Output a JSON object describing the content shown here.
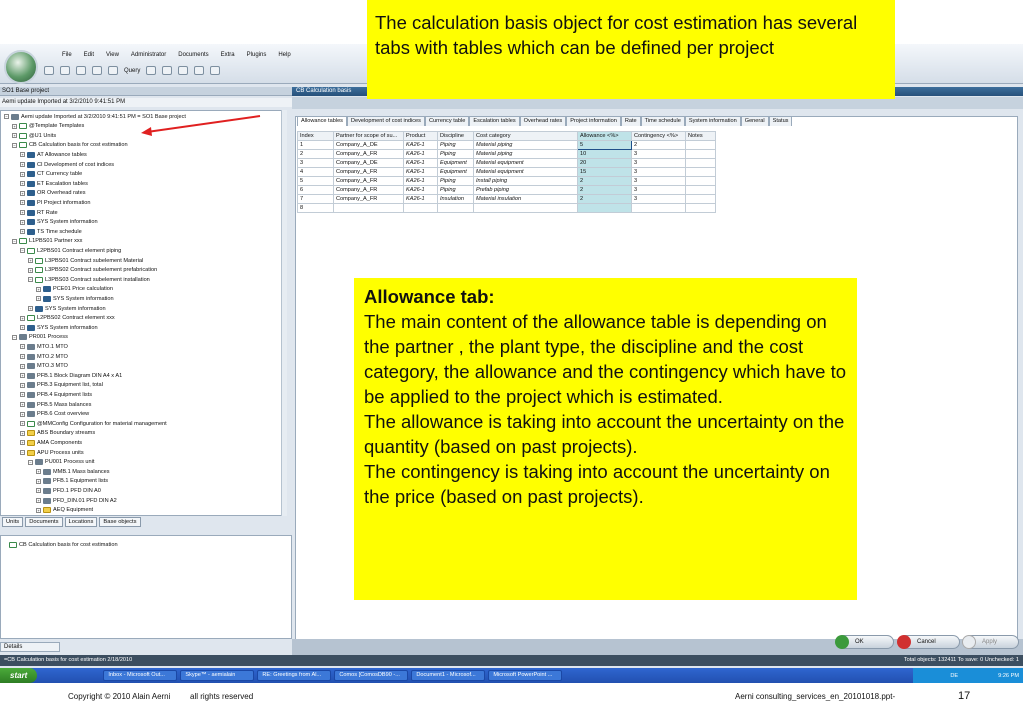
{
  "app": {
    "menus": [
      "File",
      "Edit",
      "View",
      "Administrator",
      "Documents",
      "Extra",
      "Plugins",
      "Help"
    ],
    "query_label": "Query",
    "left_header": "SO1  Base project",
    "left_header2": "Aemi  update Imported at 3/2/2010 9:41:51 PM",
    "right_header": "CB  Calculation basis"
  },
  "tree": [
    {
      "d": 0,
      "b": "⊟",
      "i": "g",
      "t": "Aemi  update Imported at 3/2/2010 9:41:51 PM  =  SO1   Base project"
    },
    {
      "d": 1,
      "b": "⊞",
      "i": "x",
      "t": "@Template  Templates"
    },
    {
      "d": 1,
      "b": "⊞",
      "i": "x",
      "t": "@U1  Units"
    },
    {
      "d": 1,
      "b": "⊟",
      "i": "x",
      "t": "CB   Calculation basis for cost estimation"
    },
    {
      "d": 2,
      "b": "⊞",
      "i": "f",
      "t": "AT   Allowance tables"
    },
    {
      "d": 2,
      "b": "⊞",
      "i": "f",
      "t": "CI   Development of cost indices"
    },
    {
      "d": 2,
      "b": "⊞",
      "i": "f",
      "t": "CT   Currency table"
    },
    {
      "d": 2,
      "b": "⊞",
      "i": "f",
      "t": "ET   Escalation tables"
    },
    {
      "d": 2,
      "b": "⊞",
      "i": "f",
      "t": "OR   Overhead rates"
    },
    {
      "d": 2,
      "b": "⊞",
      "i": "f",
      "t": "PI   Project information"
    },
    {
      "d": 2,
      "b": "⊞",
      "i": "f",
      "t": "RT   Rate"
    },
    {
      "d": 2,
      "b": "⊞",
      "i": "f",
      "t": "SYS  System information"
    },
    {
      "d": 2,
      "b": "⊞",
      "i": "f",
      "t": "TS   Time schedule"
    },
    {
      "d": 1,
      "b": "⊟",
      "i": "x",
      "t": "L1PBS01   Partner xxx"
    },
    {
      "d": 2,
      "b": "⊟",
      "i": "x",
      "t": "L2PBS01   Contract element piping"
    },
    {
      "d": 3,
      "b": "⊞",
      "i": "x",
      "t": "L3PBS01   Contract subelement Material"
    },
    {
      "d": 3,
      "b": "⊞",
      "i": "x",
      "t": "L3PBS02   Contract subelement prefabrication"
    },
    {
      "d": 3,
      "b": "⊟",
      "i": "x",
      "t": "L3PBS03   Contract subelement installation"
    },
    {
      "d": 4,
      "b": "⊞",
      "i": "f",
      "t": "PCE01   Price calculation"
    },
    {
      "d": 4,
      "b": "⊞",
      "i": "f",
      "t": "SYS   System information"
    },
    {
      "d": 3,
      "b": "⊞",
      "i": "f",
      "t": "SYS   System information"
    },
    {
      "d": 2,
      "b": "⊞",
      "i": "x",
      "t": "L2PBS02   Contract element xxx"
    },
    {
      "d": 2,
      "b": "⊞",
      "i": "f",
      "t": "SYS   System information"
    },
    {
      "d": 1,
      "b": "⊟",
      "i": "d",
      "t": "PR001   Process"
    },
    {
      "d": 2,
      "b": "⊞",
      "i": "d",
      "t": "MTO.1  MTO"
    },
    {
      "d": 2,
      "b": "⊞",
      "i": "d",
      "t": "MTO.2  MTO"
    },
    {
      "d": 2,
      "b": "⊞",
      "i": "d",
      "t": "MTO.3  MTO"
    },
    {
      "d": 2,
      "b": "⊞",
      "i": "d",
      "t": "PFB.1  Block Diagram DIN A4 x A1"
    },
    {
      "d": 2,
      "b": "⊞",
      "i": "d",
      "t": "PFB.3  Equipment list, total"
    },
    {
      "d": 2,
      "b": "⊞",
      "i": "d",
      "t": "PFB.4  Equipment lists"
    },
    {
      "d": 2,
      "b": "⊞",
      "i": "d",
      "t": "PFB.5  Mass balances"
    },
    {
      "d": 2,
      "b": "⊞",
      "i": "d",
      "t": "PFB.6  Cost overview"
    },
    {
      "d": 2,
      "b": "⊞",
      "i": "x",
      "t": "@MMConfig   Configuration for material management"
    },
    {
      "d": 2,
      "b": "⊞",
      "i": "y",
      "t": "ABS   Boundary streams"
    },
    {
      "d": 2,
      "b": "⊞",
      "i": "y",
      "t": "AMA   Components"
    },
    {
      "d": 2,
      "b": "⊟",
      "i": "y",
      "t": "APU   Process units"
    },
    {
      "d": 3,
      "b": "⊟",
      "i": "d",
      "t": "PU001   Process unit"
    },
    {
      "d": 4,
      "b": "⊞",
      "i": "d",
      "t": "MMB.1  Mass balances"
    },
    {
      "d": 4,
      "b": "⊞",
      "i": "d",
      "t": "PFB.1  Equipment lists"
    },
    {
      "d": 4,
      "b": "⊞",
      "i": "d",
      "t": "PFD.1  PFD DIN A0"
    },
    {
      "d": 4,
      "b": "⊞",
      "i": "d",
      "t": "PFD_DIN.01  PFD DIN A2"
    },
    {
      "d": 4,
      "b": "⊞",
      "i": "y",
      "t": "AEQ   Equipment"
    }
  ],
  "left_tabs": [
    "Units",
    "Documents",
    "Locations",
    "Base objects"
  ],
  "lower_item": "CB   Calculation basis for cost estimation",
  "details_tab": "Details",
  "tabs": [
    "Allowance tables",
    "Development of cost indices",
    "Currency table",
    "Escalation tables",
    "Overhead rates",
    "Project information",
    "Rate",
    "Time schedule",
    "System information",
    "General",
    "Status"
  ],
  "grid": {
    "headers": [
      "Index",
      "Partner for scope of su...",
      "Product",
      "Discipline",
      "Cost category",
      "Allowance <%>",
      "Contingency <%>",
      "Notes"
    ],
    "rows": [
      [
        "1",
        "Company_A_DE",
        "KA26-1",
        "Piping",
        "Material piping",
        "5",
        "2",
        ""
      ],
      [
        "2",
        "Company_A_FR",
        "KA26-1",
        "Piping",
        "Material piping",
        "10",
        "3",
        ""
      ],
      [
        "3",
        "Company_A_DE",
        "KA26-1",
        "Equipment",
        "Material equipment",
        "20",
        "3",
        ""
      ],
      [
        "4",
        "Company_A_FR",
        "KA26-1",
        "Equipment",
        "Material equipment",
        "15",
        "3",
        ""
      ],
      [
        "5",
        "Company_A_FR",
        "KA26-1",
        "Piping",
        "Install piping",
        "2",
        "3",
        ""
      ],
      [
        "6",
        "Company_A_FR",
        "KA26-1",
        "Piping",
        "Prefab piping",
        "2",
        "3",
        ""
      ],
      [
        "7",
        "Company_A_FR",
        "KA26-1",
        "Insulation",
        "Material insulation",
        "2",
        "3",
        ""
      ],
      [
        "8",
        "",
        "",
        "",
        "",
        "",
        "",
        ""
      ]
    ]
  },
  "buttons": {
    "ok": "OK",
    "cancel": "Cancel",
    "apply": "Apply"
  },
  "status_left": "=CB  Calculation basis for cost estimation   2/18/2010",
  "status_right": "Total objects: 132411   To save: 0   Unchecked: 1",
  "taskbar": {
    "start": "start",
    "items": [
      "Inbox - Microsoft Out...",
      "Skype™ - aemialain",
      "RE: Greetings from Al...",
      "Comos [ComosDB90 -...",
      "Document1 - Microsof...",
      "Microsoft PowerPoint ..."
    ],
    "clock": "9:26 PM",
    "lang": "DE"
  },
  "callout1": "The calculation basis object for cost estimation has several tabs with tables which can be defined per project",
  "callout2": {
    "title": "Allowance tab:",
    "p1": "The main content of the allowance table is depending on the partner , the plant type, the discipline and the cost category, the allowance and the contingency which have to be applied to the project which is estimated.",
    "p2": "The allowance is taking into account the uncertainty on the quantity (based on past projects).",
    "p3": "The contingency is taking into account the uncertainty on the price (based on past projects)."
  },
  "footer": {
    "copyright": "Copyright  © 2010 Alain Aerni",
    "rights": "all rights reserved",
    "file": "Aerni consulting_services_en_20101018.ppt-",
    "page": "17"
  },
  "colors": {
    "callout": "#ffff00",
    "highlight": "#bfe3e8",
    "arrow": "#e02020"
  }
}
